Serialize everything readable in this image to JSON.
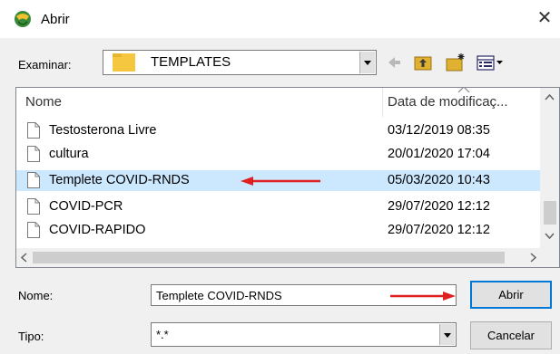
{
  "window": {
    "title": "Abrir"
  },
  "lookin": {
    "label": "Examinar:",
    "value": "TEMPLATES"
  },
  "list": {
    "columns": [
      "Nome",
      "Data de modificaç..."
    ],
    "rows": [
      {
        "name": "Testosterona Livre",
        "date": "03/12/2019 08:35",
        "selected": false
      },
      {
        "name": "cultura",
        "date": "20/01/2020 17:04",
        "selected": false
      },
      {
        "name": "Templete COVID-RNDS",
        "date": "05/03/2020 10:43",
        "selected": true
      },
      {
        "name": "COVID-PCR",
        "date": "29/07/2020 12:12",
        "selected": false
      },
      {
        "name": "COVID-RAPIDO",
        "date": "29/07/2020 12:12",
        "selected": false
      }
    ]
  },
  "filename": {
    "label": "Nome:",
    "value": "Templete COVID-RNDS"
  },
  "filetype": {
    "label": "Tipo:",
    "value": "*.*"
  },
  "buttons": {
    "open": "Abrir",
    "cancel": "Cancelar"
  },
  "colors": {
    "selection": "#cce8ff",
    "annotation_arrow": "#e02020",
    "folder": "#f5c640"
  },
  "icons": [
    "app-icon",
    "close-icon",
    "folder-icon",
    "back-arrow-icon",
    "up-folder-icon",
    "new-folder-icon",
    "view-menu-icon",
    "file-icon",
    "sort-indicator-icon",
    "scroll-up-icon",
    "scroll-down-icon",
    "scroll-left-icon",
    "scroll-right-icon",
    "red-arrow-icon"
  ]
}
